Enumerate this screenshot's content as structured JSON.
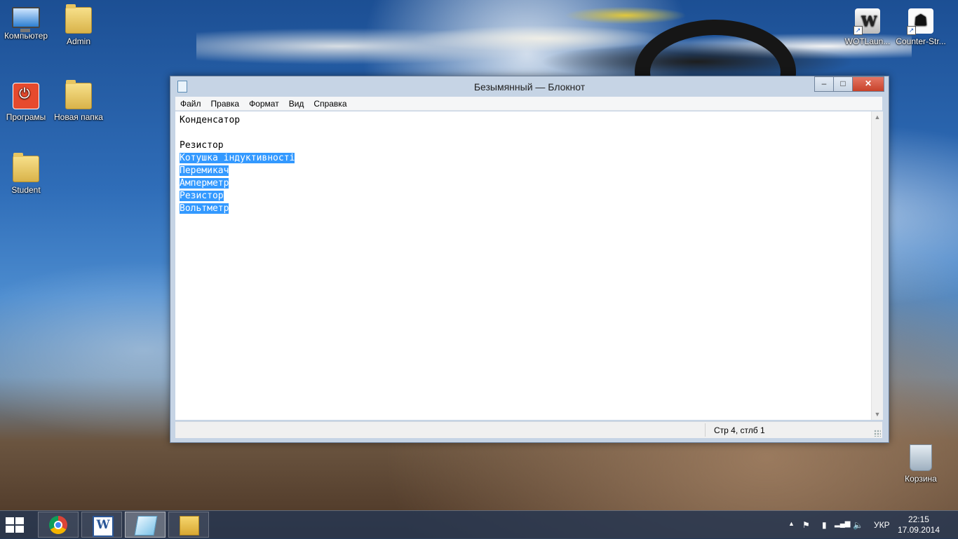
{
  "desktop": {
    "icons": [
      {
        "label": "Компьютер",
        "icon": "computer-icon"
      },
      {
        "label": "Admin",
        "icon": "user-folder-icon"
      },
      {
        "label": "Програмы",
        "icon": "power-icon"
      },
      {
        "label": "Новая папка",
        "icon": "folder-icon"
      },
      {
        "label": "Student",
        "icon": "folder-icon"
      },
      {
        "label": "WOTLaun...",
        "icon": "wot-launcher-icon"
      },
      {
        "label": "Counter-Str...",
        "icon": "counter-strike-icon"
      },
      {
        "label": "Корзина",
        "icon": "recycle-bin-icon"
      }
    ]
  },
  "window": {
    "title": "Безымянный — Блокнот",
    "controls": {
      "minimize": "–",
      "maximize": "□",
      "close": "✕"
    },
    "menu": [
      "Файл",
      "Правка",
      "Формат",
      "Вид",
      "Справка"
    ],
    "lines": [
      {
        "text": "Конденсатор",
        "selected": false
      },
      {
        "text": "",
        "selected": false
      },
      {
        "text": "Резистор",
        "selected": false
      },
      {
        "text": "Котушка індуктивності",
        "selected": true
      },
      {
        "text": "Перемикач",
        "selected": true
      },
      {
        "text": "Амперметр",
        "selected": true
      },
      {
        "text": "Резистор",
        "selected": true
      },
      {
        "text": "Вольтметр",
        "selected": true
      }
    ],
    "status": "Стр 4, стлб 1"
  },
  "taskbar": {
    "pinned": [
      "chrome-icon",
      "word-icon",
      "notepad-icon",
      "explorer-icon"
    ],
    "active": "notepad-icon",
    "tray": {
      "language": "УКР",
      "time": "22:15",
      "date": "17.09.2014"
    }
  },
  "colors": {
    "selection": "#3399ff",
    "close_button": "#c7422a",
    "taskbar": "#28374f"
  }
}
